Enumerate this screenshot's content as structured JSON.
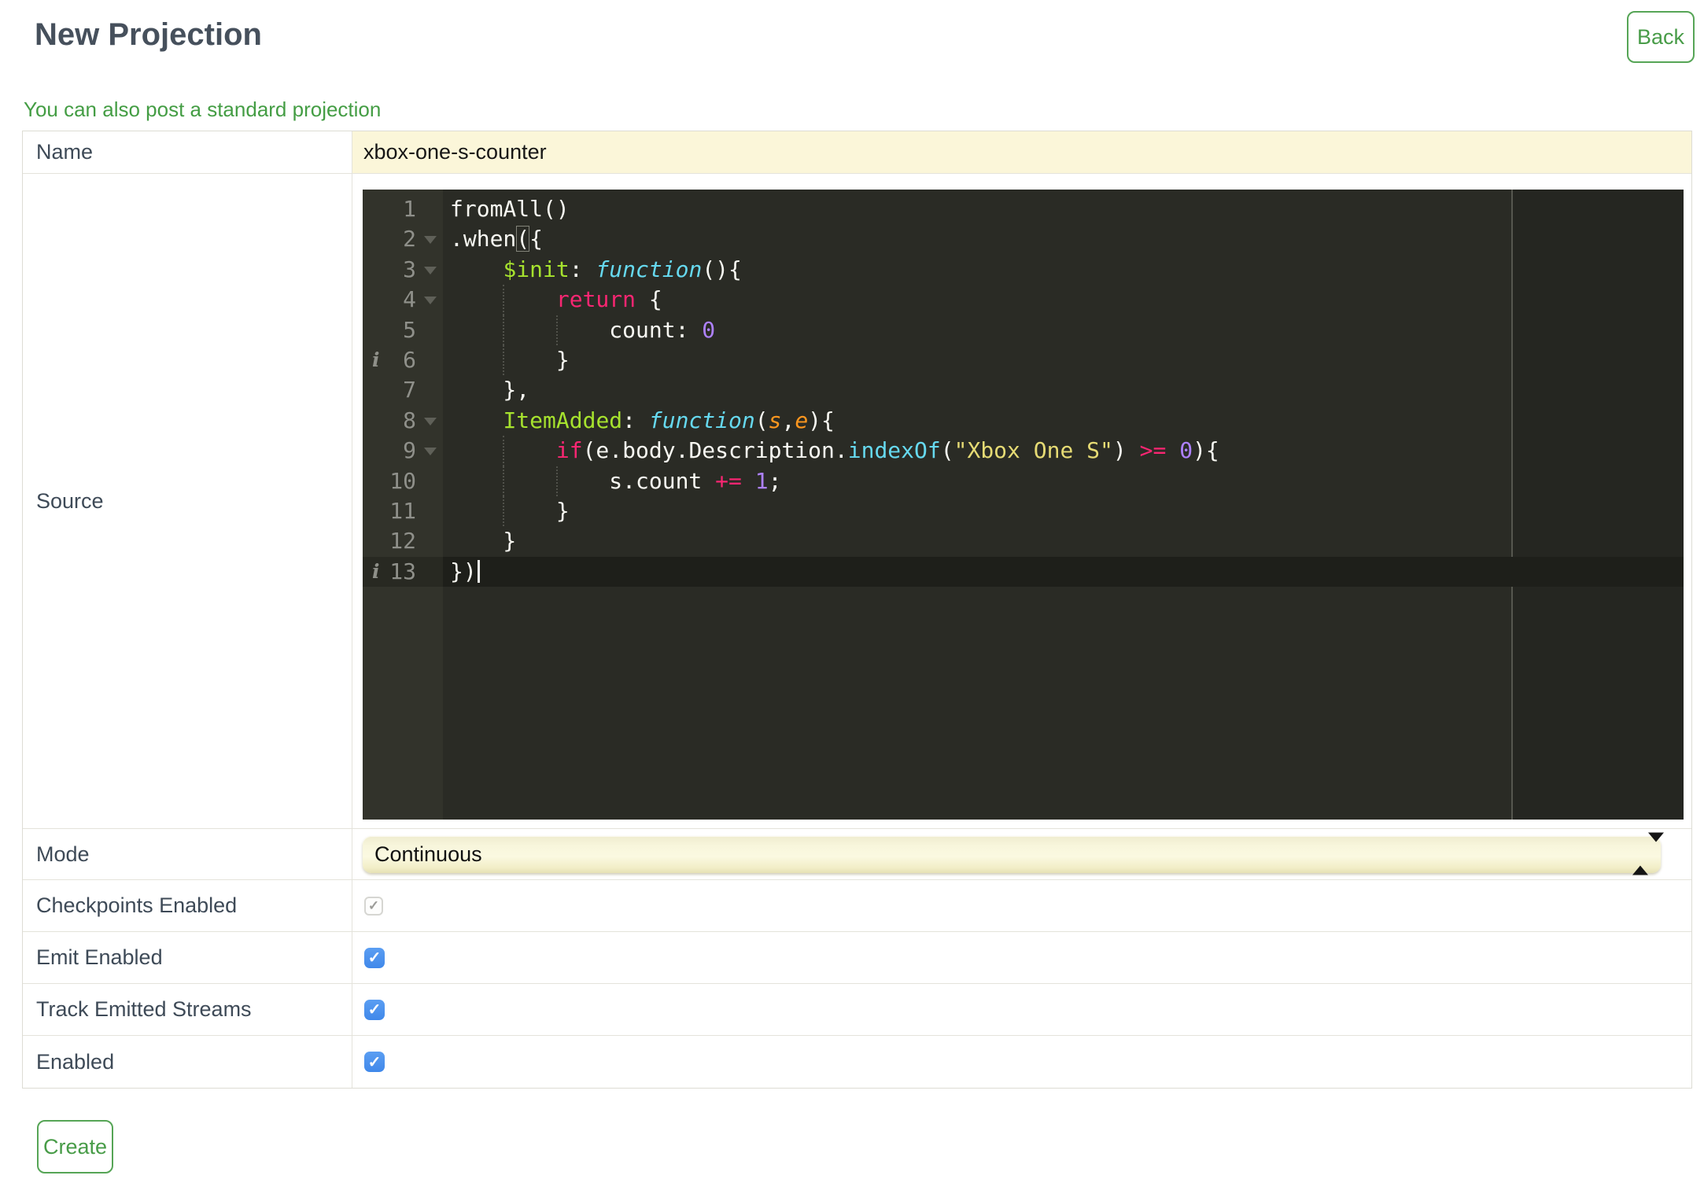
{
  "header": {
    "title": "New Projection",
    "back_label": "Back",
    "link_text": "You can also post a standard projection"
  },
  "footer": {
    "create_label": "Create"
  },
  "form": {
    "name": {
      "label": "Name",
      "value": "xbox-one-s-counter"
    },
    "source": {
      "label": "Source"
    },
    "mode": {
      "label": "Mode",
      "value": "Continuous"
    },
    "checkpoints": {
      "label": "Checkpoints Enabled",
      "checked": true,
      "disabled": true
    },
    "emit": {
      "label": "Emit Enabled",
      "checked": true,
      "disabled": false
    },
    "track": {
      "label": "Track Emitted Streams",
      "checked": true,
      "disabled": false
    },
    "enabled": {
      "label": "Enabled",
      "checked": true,
      "disabled": false
    }
  },
  "icons": {
    "check_icon": "✓",
    "select_sort_arrows_icon": "▲▼",
    "fold_arrow_icon": "▾",
    "info_annotation_icon": "i"
  },
  "editor": {
    "active_line": 13,
    "cursor_line": 13,
    "print_margin_column": 80,
    "fold_lines": [
      2,
      3,
      4,
      8,
      9
    ],
    "info_lines": [
      6,
      13
    ],
    "lines": [
      {
        "n": 1,
        "tokens": [
          [
            "text",
            "fromAll()"
          ]
        ]
      },
      {
        "n": 2,
        "tokens": [
          [
            "text",
            ".when"
          ],
          [
            "match",
            "("
          ],
          [
            "text",
            "{"
          ]
        ]
      },
      {
        "n": 3,
        "tokens": [
          [
            "text",
            "    "
          ],
          [
            "key",
            "$init"
          ],
          [
            "text",
            ": "
          ],
          [
            "fnkw",
            "function"
          ],
          [
            "text",
            "(){"
          ]
        ]
      },
      {
        "n": 4,
        "tokens": [
          [
            "text",
            "        "
          ],
          [
            "kw",
            "return"
          ],
          [
            "text",
            " {"
          ]
        ]
      },
      {
        "n": 5,
        "tokens": [
          [
            "text",
            "            count: "
          ],
          [
            "num",
            "0"
          ]
        ]
      },
      {
        "n": 6,
        "tokens": [
          [
            "text",
            "        }"
          ]
        ]
      },
      {
        "n": 7,
        "tokens": [
          [
            "text",
            "    },"
          ]
        ]
      },
      {
        "n": 8,
        "tokens": [
          [
            "text",
            "    "
          ],
          [
            "key",
            "ItemAdded"
          ],
          [
            "text",
            ": "
          ],
          [
            "fnkw",
            "function"
          ],
          [
            "text",
            "("
          ],
          [
            "arg",
            "s"
          ],
          [
            "text",
            ","
          ],
          [
            "arg",
            "e"
          ],
          [
            "text",
            "){"
          ]
        ]
      },
      {
        "n": 9,
        "tokens": [
          [
            "text",
            "        "
          ],
          [
            "kw",
            "if"
          ],
          [
            "text",
            "(e.body.Description."
          ],
          [
            "support",
            "indexOf"
          ],
          [
            "text",
            "("
          ],
          [
            "str",
            "\"Xbox One S\""
          ],
          [
            "text",
            ") "
          ],
          [
            "kw",
            ">="
          ],
          [
            "text",
            " "
          ],
          [
            "num",
            "0"
          ],
          [
            "text",
            "){"
          ]
        ]
      },
      {
        "n": 10,
        "tokens": [
          [
            "text",
            "            s.count "
          ],
          [
            "kw",
            "+="
          ],
          [
            "text",
            " "
          ],
          [
            "num",
            "1"
          ],
          [
            "text",
            ";"
          ]
        ]
      },
      {
        "n": 11,
        "tokens": [
          [
            "text",
            "        }"
          ]
        ]
      },
      {
        "n": 12,
        "tokens": [
          [
            "text",
            "    }"
          ]
        ]
      },
      {
        "n": 13,
        "tokens": [
          [
            "text",
            "})"
          ]
        ]
      }
    ]
  },
  "colors": {
    "accent_green_border": "#56a556",
    "accent_green_text": "#449d44",
    "title_text": "#46505c",
    "label_text": "#3e4a57",
    "field_yellow": "#fbf6d9",
    "checkbox_blue": "#4a90ec",
    "editor": {
      "background": "#2a2b25",
      "gutter": "#32332b",
      "gutter_text": "#8f908a",
      "active_line": "#1e1f1a",
      "text": "#f8f8f2",
      "keyword": "#f92672",
      "property": "#a6e22e",
      "function_keyword": "#66d9ef",
      "argument": "#fd971f",
      "number": "#ae81ff",
      "string": "#e6db74"
    }
  }
}
